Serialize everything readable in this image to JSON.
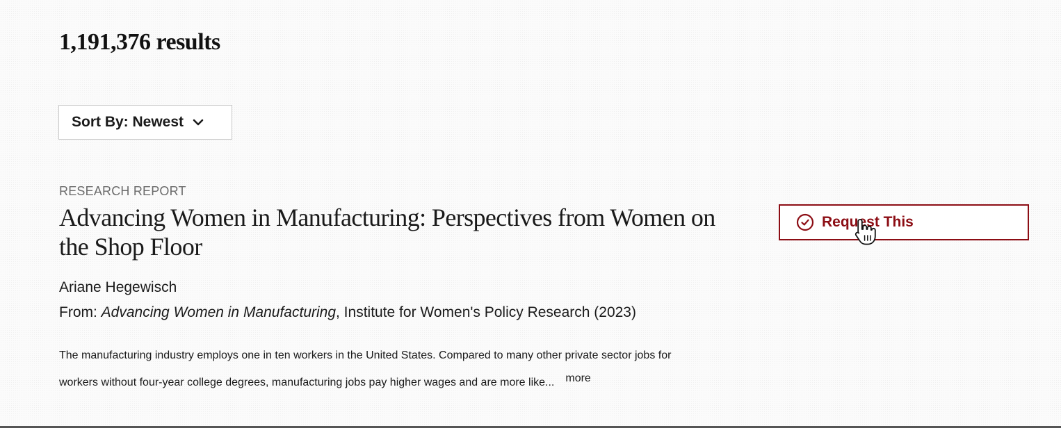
{
  "results": {
    "count_text": "1,191,376 results"
  },
  "sort": {
    "label": "Sort By: Newest",
    "icon": "chevron-down-icon"
  },
  "result": {
    "type": "RESEARCH REPORT",
    "title": "Advancing Women in Manufacturing: Perspectives from Women on the Shop Floor",
    "author": "Ariane Hegewisch",
    "source_prefix": "From: ",
    "source_title": "Advancing Women in Manufacturing",
    "source_suffix": ", Institute for Women's Policy Research (2023)",
    "abstract_line1": "The manufacturing industry employs one in ten workers in the United States. Compared to many other private sector jobs for",
    "abstract_line2": "workers without four-year college degrees, manufacturing jobs pay higher wages and are more like...",
    "more_label": "more"
  },
  "request_button": {
    "label": "Request This",
    "icon": "check-circle-icon",
    "color": "#8c0d14"
  },
  "cursor": {
    "icon": "hand-pointer-cursor-icon"
  }
}
